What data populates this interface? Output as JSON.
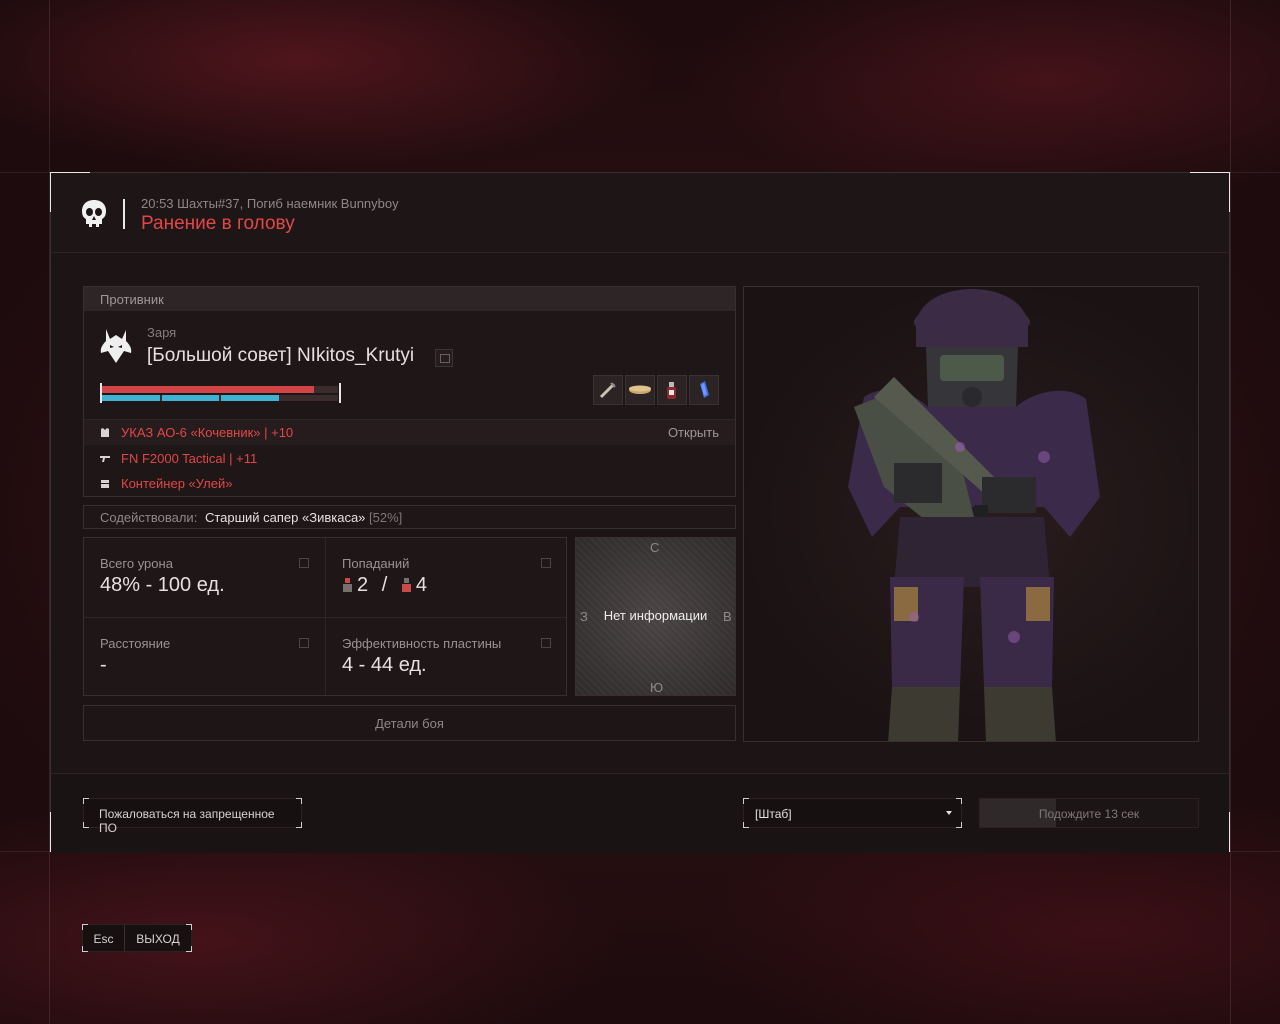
{
  "header": {
    "subtitle": "20:53 Шахты#37, Погиб наемник Bunnyboy",
    "title": "Ранение в голову"
  },
  "opponent": {
    "section_label": "Противник",
    "clan": "Заря",
    "name": "[Большой совет] NIkitos_Krutyi",
    "health_fraction": 0.9,
    "armor_segments_filled": 3,
    "armor_segments_total": 4,
    "consumables": [
      "syringe-icon",
      "plate-icon",
      "flask-icon",
      "canister-icon"
    ],
    "equipment": [
      {
        "icon": "armor-icon",
        "label": "УКАЗ АО-6 «Кочевник» | +10",
        "action": "Открыть"
      },
      {
        "icon": "weapon-icon",
        "label": "FN F2000 Tactical | +11"
      },
      {
        "icon": "container-icon",
        "label": "Контейнер «Улей»"
      }
    ]
  },
  "assist": {
    "label": "Содействовали:",
    "name": "Старший сапер «Зивкаса»",
    "percent": "[52%]"
  },
  "stats": {
    "damage": {
      "title": "Всего урона",
      "value": "48% - 100 ед."
    },
    "hits": {
      "title": "Попаданий",
      "a": "2",
      "sep": "/",
      "b": "4"
    },
    "distance": {
      "title": "Расстояние",
      "value": "-"
    },
    "plate": {
      "title": "Эффективность пластины",
      "value": "4 - 44 ед."
    }
  },
  "map": {
    "n": "С",
    "s": "Ю",
    "w": "З",
    "e": "В",
    "info": "Нет информации"
  },
  "details_label": "Детали боя",
  "footer": {
    "report_label": "Пожаловаться на запрещенное ПО",
    "location_selected": "[Штаб]",
    "wait_label": "Подождите 13 сек",
    "wait_progress": 0.35
  },
  "exit": {
    "key": "Esc",
    "label": "ВЫХОД"
  },
  "colors": {
    "accent_red": "#e04848",
    "armor_blue": "#3fb1d3",
    "hp_red": "#d34447"
  }
}
